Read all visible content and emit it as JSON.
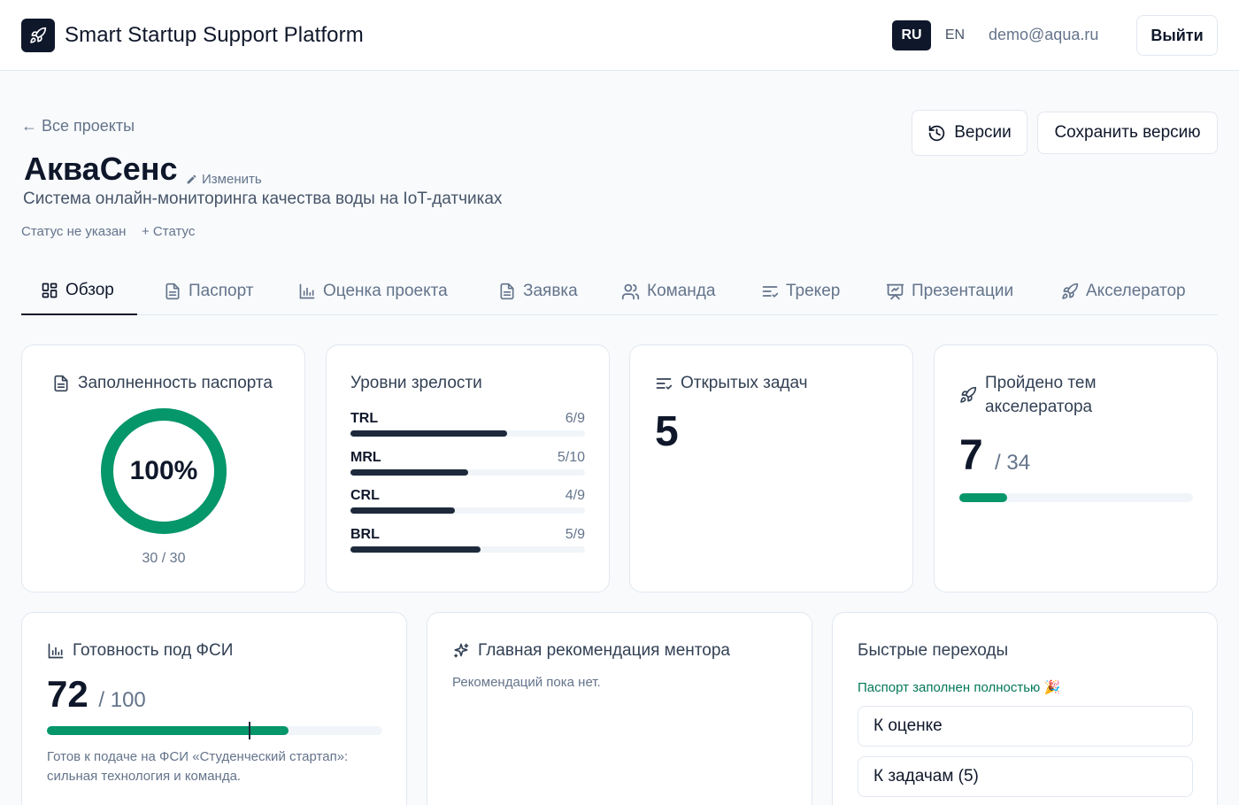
{
  "header": {
    "app_title": "Smart Startup Support Platform",
    "logo_icon": "rocket-icon",
    "lang_ru": "RU",
    "lang_en": "EN",
    "active_lang": "RU",
    "user_email": "demo@aqua.ru",
    "logout_label": "Выйти"
  },
  "project": {
    "back_label": "← Все проекты",
    "name": "АкваСенс",
    "edit_label": "Изменить",
    "description": "Система онлайн-мониторинга качества воды на IoT-датчиках",
    "status": "Статус не указан",
    "add_status_label": "+ Статус",
    "versions_label": "Версии",
    "save_version_label": "Сохранить версию"
  },
  "tabs": [
    {
      "label": "Обзор",
      "icon": "dashboard-icon",
      "active": true
    },
    {
      "label": "Паспорт",
      "icon": "document-icon",
      "active": false
    },
    {
      "label": "Оценка проекта",
      "icon": "bar-chart-icon",
      "active": false
    },
    {
      "label": "Заявка",
      "icon": "document-icon",
      "active": false
    },
    {
      "label": "Команда",
      "icon": "users-icon",
      "active": false
    },
    {
      "label": "Трекер",
      "icon": "tasks-icon",
      "active": false
    },
    {
      "label": "Презентации",
      "icon": "presentation-icon",
      "active": false
    },
    {
      "label": "Акселератор",
      "icon": "rocket-icon",
      "active": false
    }
  ],
  "passport_card": {
    "title": "Заполненность паспорта",
    "percent_label": "100%",
    "percent": 100,
    "count_label": "30 / 30",
    "color": "#059669"
  },
  "maturity_card": {
    "title": "Уровни зрелости",
    "levels": [
      {
        "name": "TRL",
        "label": "6/9",
        "value": 6,
        "max": 9
      },
      {
        "name": "MRL",
        "label": "5/10",
        "value": 5,
        "max": 10
      },
      {
        "name": "CRL",
        "label": "4/9",
        "value": 4,
        "max": 9
      },
      {
        "name": "BRL",
        "label": "5/9",
        "value": 5,
        "max": 9
      }
    ]
  },
  "tasks_card": {
    "title": "Открытых задач",
    "count": "5"
  },
  "accelerator_card": {
    "title": "Пройдено тем акселератора",
    "done": "7",
    "total_label": "/ 34",
    "done_value": 7,
    "total_value": 34
  },
  "readiness_card": {
    "title": "Готовность под ФСИ",
    "score": "72",
    "max_label": "/ 100",
    "score_value": 72,
    "max_value": 100,
    "description": "Готов к подаче на ФСИ «Студенческий стартап»: сильная технология и команда."
  },
  "mentor_card": {
    "title": "Главная рекомендация ментора",
    "empty_text": "Рекомендаций пока нет."
  },
  "quick_card": {
    "title": "Быстрые переходы",
    "passport_status": "Паспорт заполнен полностью 🎉",
    "to_evaluation": "К оценке",
    "to_tasks": "К задачам (5)"
  }
}
